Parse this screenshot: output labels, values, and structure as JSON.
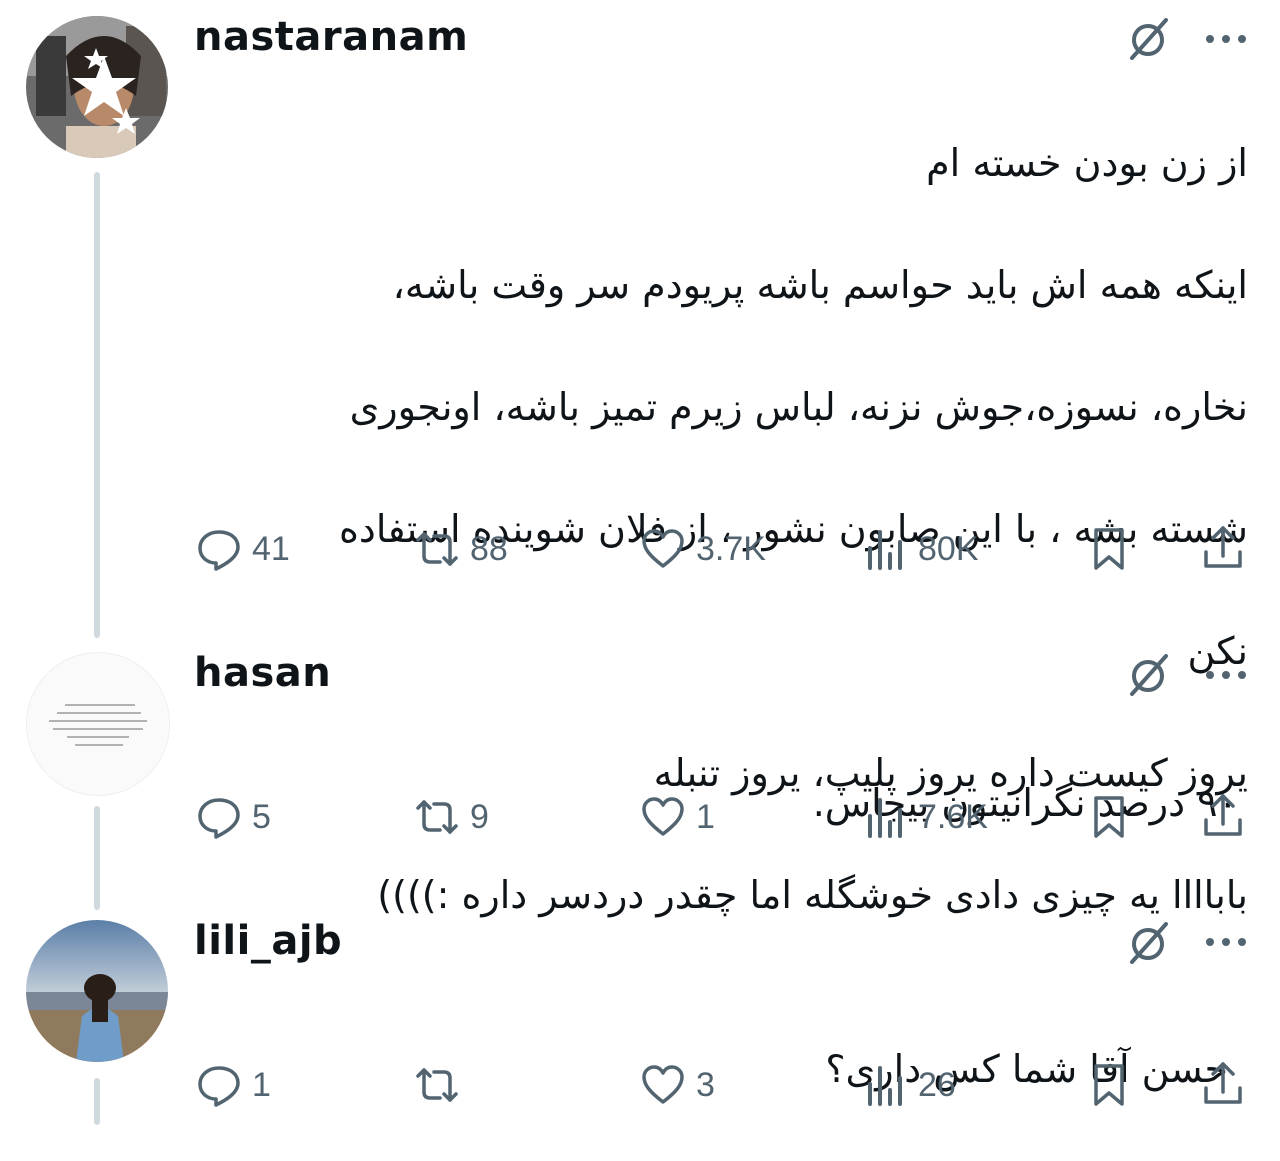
{
  "tweets": [
    {
      "username": "nastaranam",
      "lines": [
        "از زن بودن خسته ام",
        "اینکه همه اش باید حواسم باشه پریودم سر وقت باشه،",
        "نخاره، نسوزه،جوش نزنه، لباس زیرم تمیز باشه، اونجوری",
        "شسته بشه ، با این صابون نشور ، از فلان شوینده استفاده",
        "نکن",
        "یروز کیست داره یروز پلیپ،  یروز تنبله",
        "باباااا یه چیزی دادی خوشگله اما چقدر دردسر داره :))))"
      ],
      "replies": "41",
      "reposts": "88",
      "likes": "3.7K",
      "views": "80K",
      "avatar_icon": "censored-avatar-icon"
    },
    {
      "username": "hasan",
      "lines": [
        "۹۰ درصد نگرانیتون بیجاس."
      ],
      "replies": "5",
      "reposts": "9",
      "likes": "1",
      "views": "7.6K",
      "avatar_icon": "text-image-avatar-icon"
    },
    {
      "username": "lili_ajb",
      "lines": [
        "حسن آقا شما کس داری؟"
      ],
      "replies": "1",
      "reposts": "",
      "likes": "3",
      "views": "26",
      "avatar_icon": "beach-photo-avatar-icon"
    }
  ],
  "colors": {
    "text": "#0f1419",
    "secondary": "#536471",
    "thread_line": "#cfd9de"
  }
}
